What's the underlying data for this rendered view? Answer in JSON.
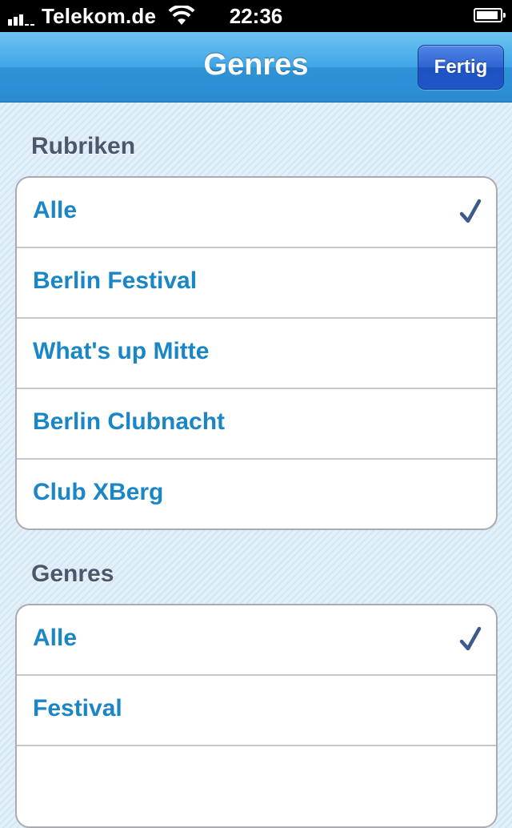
{
  "status_bar": {
    "carrier": "Telekom.de",
    "time": "22:36"
  },
  "nav": {
    "title": "Genres",
    "done_label": "Fertig"
  },
  "sections": [
    {
      "header": "Rubriken",
      "rows": [
        {
          "label": "Alle",
          "checked": true
        },
        {
          "label": "Berlin Festival",
          "checked": false
        },
        {
          "label": "What's up Mitte",
          "checked": false
        },
        {
          "label": "Berlin Clubnacht",
          "checked": false
        },
        {
          "label": "Club XBerg",
          "checked": false
        }
      ]
    },
    {
      "header": "Genres",
      "rows": [
        {
          "label": "Alle",
          "checked": true
        },
        {
          "label": "Festival",
          "checked": false
        },
        {
          "label": "",
          "checked": false
        }
      ]
    }
  ],
  "colors": {
    "row_text": "#1a86c6",
    "checkmark": "#3d5a8a",
    "nav_gradient_top": "#6fc3f2",
    "done_button": "#2e63d1"
  }
}
